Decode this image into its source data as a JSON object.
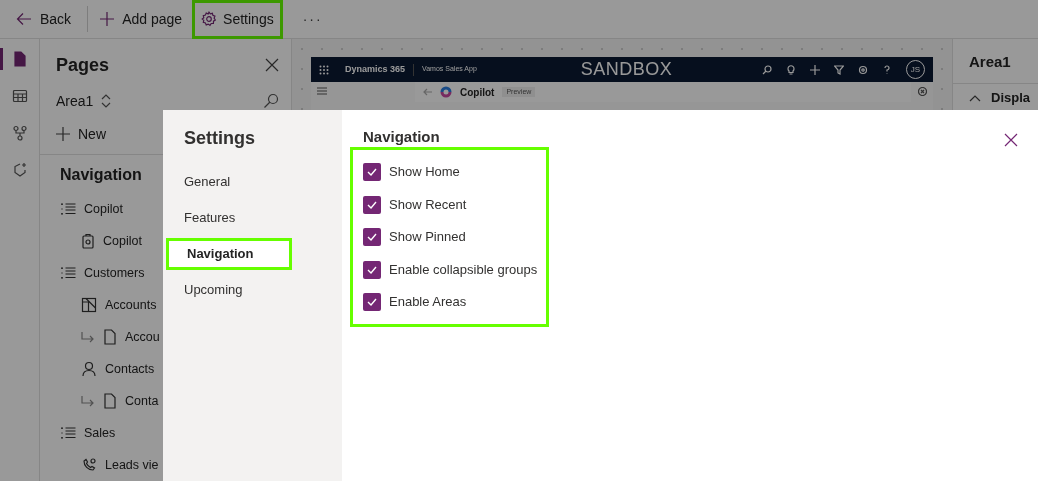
{
  "toolbar": {
    "back": "Back",
    "add_page": "Add page",
    "settings": "Settings",
    "more": "···"
  },
  "rail": [
    {
      "kind": "page",
      "selected": true
    },
    {
      "kind": "table",
      "selected": false
    },
    {
      "kind": "flow",
      "selected": false
    },
    {
      "kind": "sparkle",
      "selected": false
    }
  ],
  "pages_panel": {
    "title": "Pages",
    "area": "Area1",
    "new": "New",
    "section": "Navigation",
    "tree": [
      {
        "label": "Copilot",
        "kind": "group",
        "children": [
          {
            "label": "Copilot",
            "kind": "copilot"
          }
        ]
      },
      {
        "label": "Customers",
        "kind": "group",
        "children": [
          {
            "label": "Accounts",
            "kind": "dashboard"
          },
          {
            "label": "Accou",
            "kind": "subpage"
          },
          {
            "label": "Contacts",
            "kind": "contact"
          },
          {
            "label": "Conta",
            "kind": "subpage"
          }
        ]
      },
      {
        "label": "Sales",
        "kind": "group",
        "children": [
          {
            "label": "Leads vie",
            "kind": "leads"
          }
        ]
      }
    ]
  },
  "preview": {
    "brand": "Dynamics 365",
    "app": "Vamos Sales App",
    "banner": "SANDBOX",
    "avatar": "JS",
    "page_title": "Copilot",
    "badge": "Preview"
  },
  "right_panel": {
    "title": "Area1",
    "section": "Displa"
  },
  "dialog": {
    "title": "Settings",
    "nav": [
      {
        "label": "General",
        "selected": false
      },
      {
        "label": "Features",
        "selected": false
      },
      {
        "label": "Navigation",
        "selected": true
      },
      {
        "label": "Upcoming",
        "selected": false
      }
    ],
    "heading": "Navigation",
    "options": [
      {
        "label": "Show Home",
        "checked": true
      },
      {
        "label": "Show Recent",
        "checked": true
      },
      {
        "label": "Show Pinned",
        "checked": true
      },
      {
        "label": "Enable collapsible groups",
        "checked": true
      },
      {
        "label": "Enable Areas",
        "checked": true
      }
    ]
  }
}
